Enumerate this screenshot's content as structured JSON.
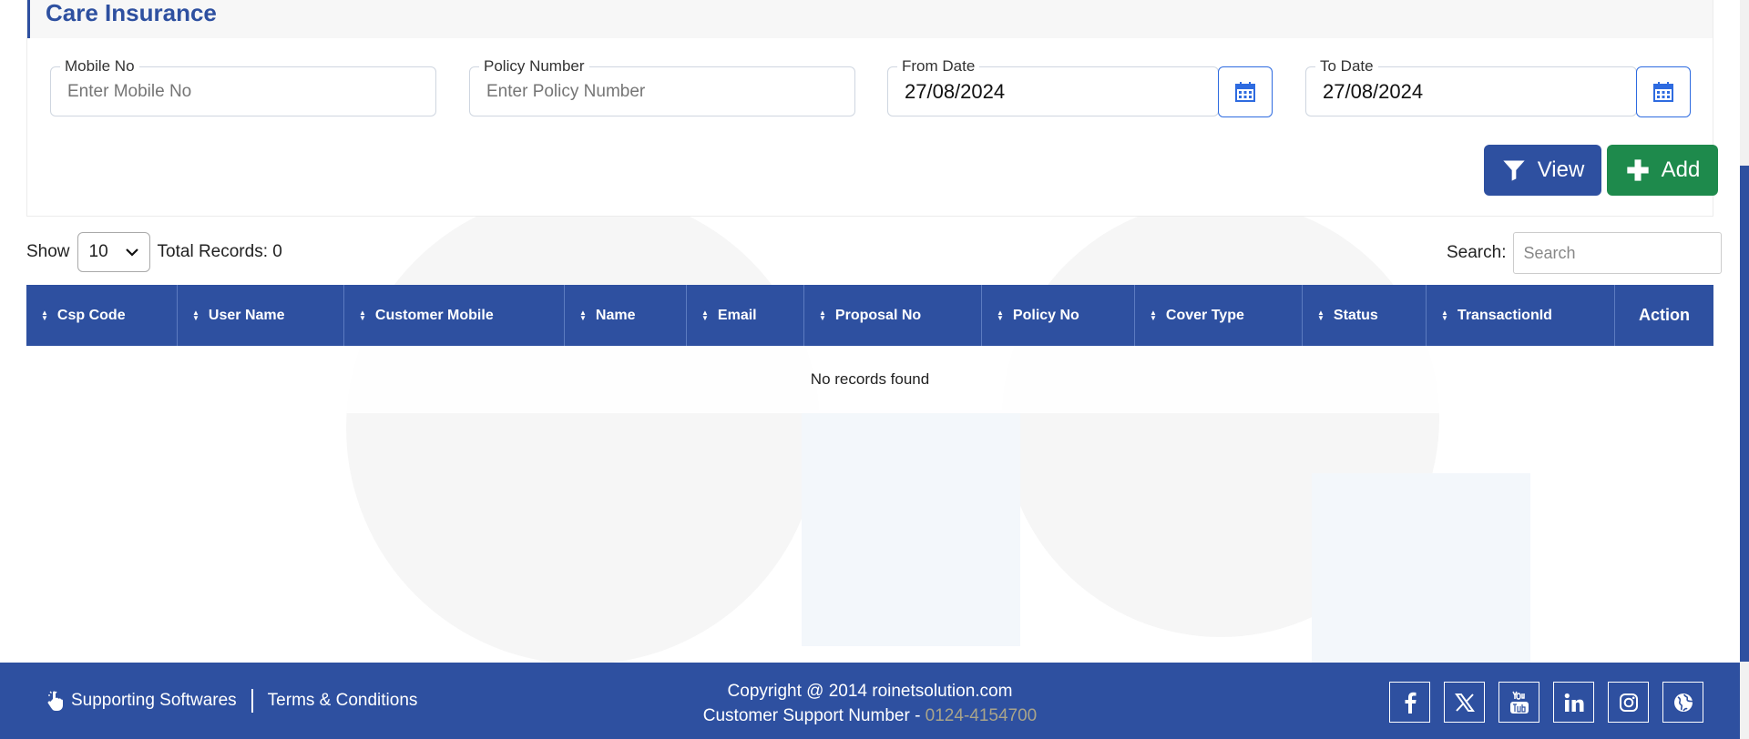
{
  "page": {
    "title": "Care Insurance"
  },
  "filters": {
    "mobile": {
      "label": "Mobile No",
      "placeholder": "Enter Mobile No",
      "value": ""
    },
    "policy": {
      "label": "Policy Number",
      "placeholder": "Enter Policy Number",
      "value": ""
    },
    "from_date": {
      "label": "From Date",
      "value": "27/08/2024"
    },
    "to_date": {
      "label": "To Date",
      "value": "27/08/2024"
    }
  },
  "buttons": {
    "view": "View",
    "add": "Add"
  },
  "table_controls": {
    "show_label": "Show",
    "page_size": "10",
    "total_records": "Total Records: 0",
    "search_label": "Search:",
    "search_placeholder": "Search"
  },
  "table": {
    "columns": [
      "Csp Code",
      "User Name",
      "Customer Mobile",
      "Name",
      "Email",
      "Proposal No",
      "Policy No",
      "Cover Type",
      "Status",
      "TransactionId",
      "Action"
    ],
    "empty_message": "No records found"
  },
  "footer": {
    "supporting": "Supporting Softwares",
    "terms": "Terms & Conditions",
    "copyright": "Copyright @ 2014 roinetsolution.com",
    "support_label": "Customer Support Number - ",
    "support_number": "0124-4154700",
    "social": [
      "facebook-icon",
      "x-icon",
      "youtube-icon",
      "linkedin-icon",
      "instagram-icon",
      "website-icon"
    ]
  },
  "colors": {
    "primary": "#2e50a0",
    "add": "#1e8a4c",
    "calendar_border": "#2e6be0"
  }
}
